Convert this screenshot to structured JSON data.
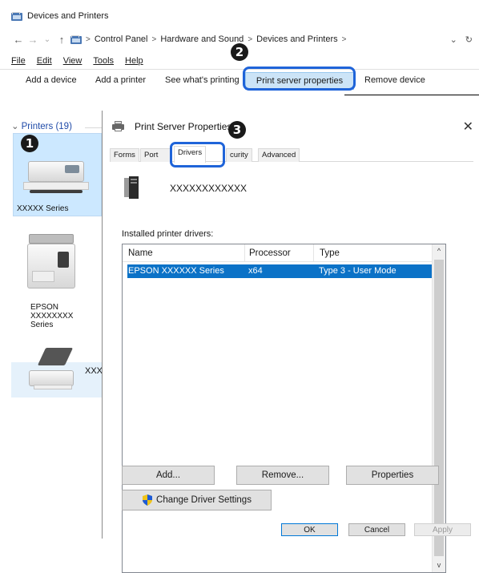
{
  "explorer": {
    "title": "Devices and Printers",
    "nav": {
      "back": "←",
      "forward": "→",
      "recent": "⌄",
      "up": "↑"
    },
    "breadcrumbs": [
      "Control Panel",
      "Hardware and Sound",
      "Devices and Printers"
    ],
    "address_dropdown": "⌄",
    "refresh": "↻",
    "menu": [
      "File",
      "Edit",
      "View",
      "Tools",
      "Help"
    ],
    "commands": {
      "add_device": "Add a device",
      "add_printer": "Add a printer",
      "see_printing": "See what's printing",
      "print_server_properties": "Print server properties",
      "remove_device": "Remove device"
    }
  },
  "printers_pane": {
    "header": "Printers (19)",
    "devices": [
      {
        "label": "XXXXX Series"
      },
      {
        "label_lines": [
          "EPSON",
          "XXXXXXXX",
          "Series"
        ]
      },
      {
        "label": "XXX"
      }
    ]
  },
  "dialog": {
    "title": "Print Server Properties",
    "close": "✕",
    "tabs": [
      "Forms",
      "Ports",
      "Drivers",
      "Security",
      "Advanced"
    ],
    "tab_visible_text": [
      "Forms",
      "Port",
      "Drivers",
      "curity",
      "Advanced"
    ],
    "active_tab": "Drivers",
    "server_name": "XXXXXXXXXXXX",
    "installed_label": "Installed printer drivers:",
    "columns": [
      "Name",
      "Processor",
      "Type"
    ],
    "rows": [
      {
        "name": "EPSON XXXXXX Series",
        "processor": "x64",
        "type": "Type 3 - User Mode",
        "selected": true
      }
    ],
    "buttons": {
      "add": "Add...",
      "remove": "Remove...",
      "properties": "Properties",
      "change_driver_settings": "Change Driver Settings",
      "ok": "OK",
      "cancel": "Cancel",
      "apply": "Apply"
    }
  },
  "callouts": [
    "1",
    "2",
    "3"
  ],
  "colors": {
    "highlight": "#1f64d9",
    "selection": "#0b72c7",
    "device_selection": "#cce8ff",
    "link_blue": "#1f4aa8"
  }
}
